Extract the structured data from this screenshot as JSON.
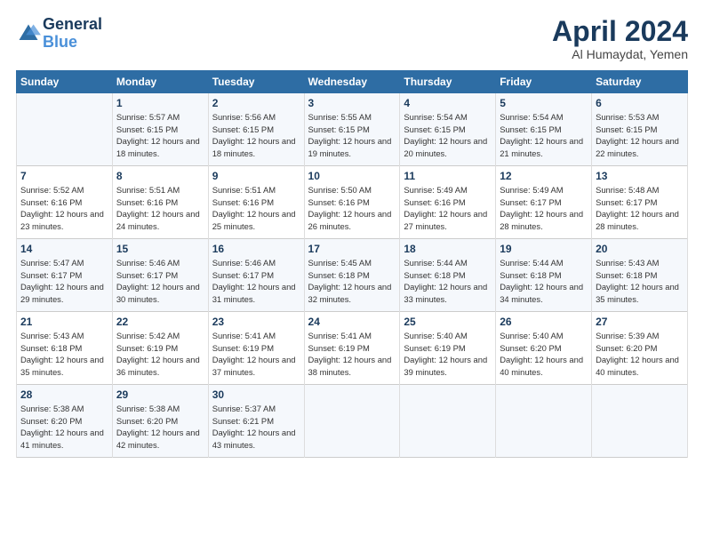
{
  "header": {
    "logo_line1": "General",
    "logo_line2": "Blue",
    "month": "April 2024",
    "location": "Al Humaydat, Yemen"
  },
  "days_of_week": [
    "Sunday",
    "Monday",
    "Tuesday",
    "Wednesday",
    "Thursday",
    "Friday",
    "Saturday"
  ],
  "weeks": [
    [
      {
        "day": "",
        "sunrise": "",
        "sunset": "",
        "daylight": ""
      },
      {
        "day": "1",
        "sunrise": "Sunrise: 5:57 AM",
        "sunset": "Sunset: 6:15 PM",
        "daylight": "Daylight: 12 hours and 18 minutes."
      },
      {
        "day": "2",
        "sunrise": "Sunrise: 5:56 AM",
        "sunset": "Sunset: 6:15 PM",
        "daylight": "Daylight: 12 hours and 18 minutes."
      },
      {
        "day": "3",
        "sunrise": "Sunrise: 5:55 AM",
        "sunset": "Sunset: 6:15 PM",
        "daylight": "Daylight: 12 hours and 19 minutes."
      },
      {
        "day": "4",
        "sunrise": "Sunrise: 5:54 AM",
        "sunset": "Sunset: 6:15 PM",
        "daylight": "Daylight: 12 hours and 20 minutes."
      },
      {
        "day": "5",
        "sunrise": "Sunrise: 5:54 AM",
        "sunset": "Sunset: 6:15 PM",
        "daylight": "Daylight: 12 hours and 21 minutes."
      },
      {
        "day": "6",
        "sunrise": "Sunrise: 5:53 AM",
        "sunset": "Sunset: 6:15 PM",
        "daylight": "Daylight: 12 hours and 22 minutes."
      }
    ],
    [
      {
        "day": "7",
        "sunrise": "Sunrise: 5:52 AM",
        "sunset": "Sunset: 6:16 PM",
        "daylight": "Daylight: 12 hours and 23 minutes."
      },
      {
        "day": "8",
        "sunrise": "Sunrise: 5:51 AM",
        "sunset": "Sunset: 6:16 PM",
        "daylight": "Daylight: 12 hours and 24 minutes."
      },
      {
        "day": "9",
        "sunrise": "Sunrise: 5:51 AM",
        "sunset": "Sunset: 6:16 PM",
        "daylight": "Daylight: 12 hours and 25 minutes."
      },
      {
        "day": "10",
        "sunrise": "Sunrise: 5:50 AM",
        "sunset": "Sunset: 6:16 PM",
        "daylight": "Daylight: 12 hours and 26 minutes."
      },
      {
        "day": "11",
        "sunrise": "Sunrise: 5:49 AM",
        "sunset": "Sunset: 6:16 PM",
        "daylight": "Daylight: 12 hours and 27 minutes."
      },
      {
        "day": "12",
        "sunrise": "Sunrise: 5:49 AM",
        "sunset": "Sunset: 6:17 PM",
        "daylight": "Daylight: 12 hours and 28 minutes."
      },
      {
        "day": "13",
        "sunrise": "Sunrise: 5:48 AM",
        "sunset": "Sunset: 6:17 PM",
        "daylight": "Daylight: 12 hours and 28 minutes."
      }
    ],
    [
      {
        "day": "14",
        "sunrise": "Sunrise: 5:47 AM",
        "sunset": "Sunset: 6:17 PM",
        "daylight": "Daylight: 12 hours and 29 minutes."
      },
      {
        "day": "15",
        "sunrise": "Sunrise: 5:46 AM",
        "sunset": "Sunset: 6:17 PM",
        "daylight": "Daylight: 12 hours and 30 minutes."
      },
      {
        "day": "16",
        "sunrise": "Sunrise: 5:46 AM",
        "sunset": "Sunset: 6:17 PM",
        "daylight": "Daylight: 12 hours and 31 minutes."
      },
      {
        "day": "17",
        "sunrise": "Sunrise: 5:45 AM",
        "sunset": "Sunset: 6:18 PM",
        "daylight": "Daylight: 12 hours and 32 minutes."
      },
      {
        "day": "18",
        "sunrise": "Sunrise: 5:44 AM",
        "sunset": "Sunset: 6:18 PM",
        "daylight": "Daylight: 12 hours and 33 minutes."
      },
      {
        "day": "19",
        "sunrise": "Sunrise: 5:44 AM",
        "sunset": "Sunset: 6:18 PM",
        "daylight": "Daylight: 12 hours and 34 minutes."
      },
      {
        "day": "20",
        "sunrise": "Sunrise: 5:43 AM",
        "sunset": "Sunset: 6:18 PM",
        "daylight": "Daylight: 12 hours and 35 minutes."
      }
    ],
    [
      {
        "day": "21",
        "sunrise": "Sunrise: 5:43 AM",
        "sunset": "Sunset: 6:18 PM",
        "daylight": "Daylight: 12 hours and 35 minutes."
      },
      {
        "day": "22",
        "sunrise": "Sunrise: 5:42 AM",
        "sunset": "Sunset: 6:19 PM",
        "daylight": "Daylight: 12 hours and 36 minutes."
      },
      {
        "day": "23",
        "sunrise": "Sunrise: 5:41 AM",
        "sunset": "Sunset: 6:19 PM",
        "daylight": "Daylight: 12 hours and 37 minutes."
      },
      {
        "day": "24",
        "sunrise": "Sunrise: 5:41 AM",
        "sunset": "Sunset: 6:19 PM",
        "daylight": "Daylight: 12 hours and 38 minutes."
      },
      {
        "day": "25",
        "sunrise": "Sunrise: 5:40 AM",
        "sunset": "Sunset: 6:19 PM",
        "daylight": "Daylight: 12 hours and 39 minutes."
      },
      {
        "day": "26",
        "sunrise": "Sunrise: 5:40 AM",
        "sunset": "Sunset: 6:20 PM",
        "daylight": "Daylight: 12 hours and 40 minutes."
      },
      {
        "day": "27",
        "sunrise": "Sunrise: 5:39 AM",
        "sunset": "Sunset: 6:20 PM",
        "daylight": "Daylight: 12 hours and 40 minutes."
      }
    ],
    [
      {
        "day": "28",
        "sunrise": "Sunrise: 5:38 AM",
        "sunset": "Sunset: 6:20 PM",
        "daylight": "Daylight: 12 hours and 41 minutes."
      },
      {
        "day": "29",
        "sunrise": "Sunrise: 5:38 AM",
        "sunset": "Sunset: 6:20 PM",
        "daylight": "Daylight: 12 hours and 42 minutes."
      },
      {
        "day": "30",
        "sunrise": "Sunrise: 5:37 AM",
        "sunset": "Sunset: 6:21 PM",
        "daylight": "Daylight: 12 hours and 43 minutes."
      },
      {
        "day": "",
        "sunrise": "",
        "sunset": "",
        "daylight": ""
      },
      {
        "day": "",
        "sunrise": "",
        "sunset": "",
        "daylight": ""
      },
      {
        "day": "",
        "sunrise": "",
        "sunset": "",
        "daylight": ""
      },
      {
        "day": "",
        "sunrise": "",
        "sunset": "",
        "daylight": ""
      }
    ]
  ]
}
